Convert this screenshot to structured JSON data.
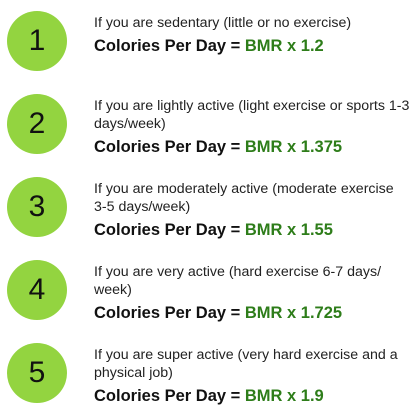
{
  "colors": {
    "badge": "#93d440",
    "text": "#222222",
    "formula_value": "#2e7d1a"
  },
  "levels": [
    {
      "number": "1",
      "description": "If you are sedentary (little or no exercise)",
      "formula_label": "Colories Per Day =",
      "formula_value": "BMR x 1.2"
    },
    {
      "number": "2",
      "description": "If you are lightly active (light exercise or sports 1-3 days/week)",
      "formula_label": "Colories Per Day =",
      "formula_value": "BMR x 1.375"
    },
    {
      "number": "3",
      "description": "If you are moderately active (moderate exercise 3-5 days/week)",
      "formula_label": "Colories Per Day =",
      "formula_value": "BMR x 1.55"
    },
    {
      "number": "4",
      "description": "If you are very active (hard exercise 6-7 days/ week)",
      "formula_label": "Colories Per Day =",
      "formula_value": "BMR x 1.725"
    },
    {
      "number": "5",
      "description": "If you are super active (very hard exercise and a physical job)",
      "formula_label": "Colories Per Day =",
      "formula_value": "BMR x 1.9"
    }
  ]
}
